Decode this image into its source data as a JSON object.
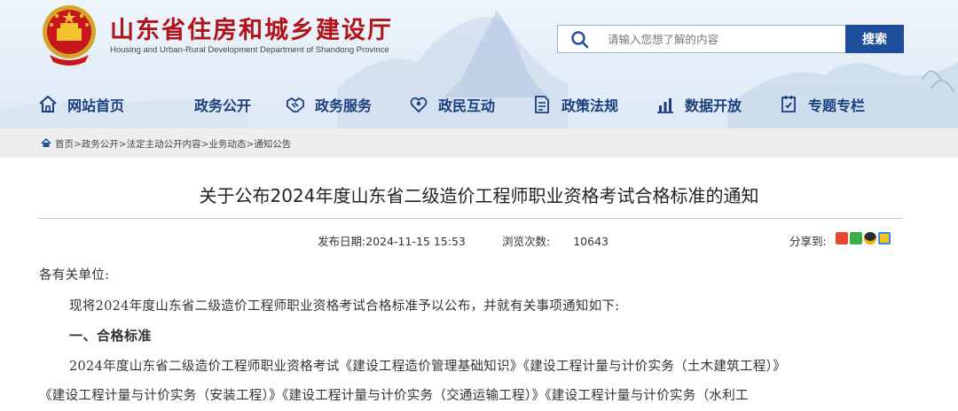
{
  "header": {
    "site_title": "山东省住房和城乡建设厅",
    "site_subtitle": "Housing and Urban-Rural Development Department of Shandong Province",
    "search_placeholder": "请输入您想了解的内容",
    "search_button": "搜索",
    "brand_color": "#b0141a",
    "accent_color": "#1f4f9a"
  },
  "nav": {
    "items": [
      {
        "label": "网站首页",
        "icon": "home-icon"
      },
      {
        "label": "政务公开",
        "icon": ""
      },
      {
        "label": "政务服务",
        "icon": "handshake-icon"
      },
      {
        "label": "政民互动",
        "icon": "interaction-icon"
      },
      {
        "label": "政策法规",
        "icon": "document-icon"
      },
      {
        "label": "数据开放",
        "icon": "chart-icon"
      },
      {
        "label": "专题专栏",
        "icon": "topic-icon"
      }
    ]
  },
  "breadcrumb": {
    "items": [
      "首页",
      "政务公开",
      "法定主动公开内容",
      "业务动态",
      "通知公告"
    ],
    "separator": ">"
  },
  "article": {
    "title": "关于公布2024年度山东省二级造价工程师职业资格考试合格标准的通知",
    "publish_label": "发布日期:",
    "publish_date": "2024-11-15 15:53",
    "views_label": "浏览次数:",
    "views_count": "10643",
    "share_label": "分享到:",
    "share_icons": [
      "weibo-icon",
      "wechat-icon",
      "qq-icon",
      "qzone-icon"
    ],
    "paragraphs": [
      "各有关单位:",
      "现将2024年度山东省二级造价工程师职业资格考试合格标准予以公布，并就有关事项通知如下:",
      "一、合格标准",
      "2024年度山东省二级造价工程师职业资格考试《建设工程造价管理基础知识》《建设工程计量与计价实务（土木建筑工程）》",
      "《建设工程计量与计价实务（安装工程）》《建设工程计量与计价实务（交通运输工程）》《建设工程计量与计价实务（水利工"
    ]
  }
}
